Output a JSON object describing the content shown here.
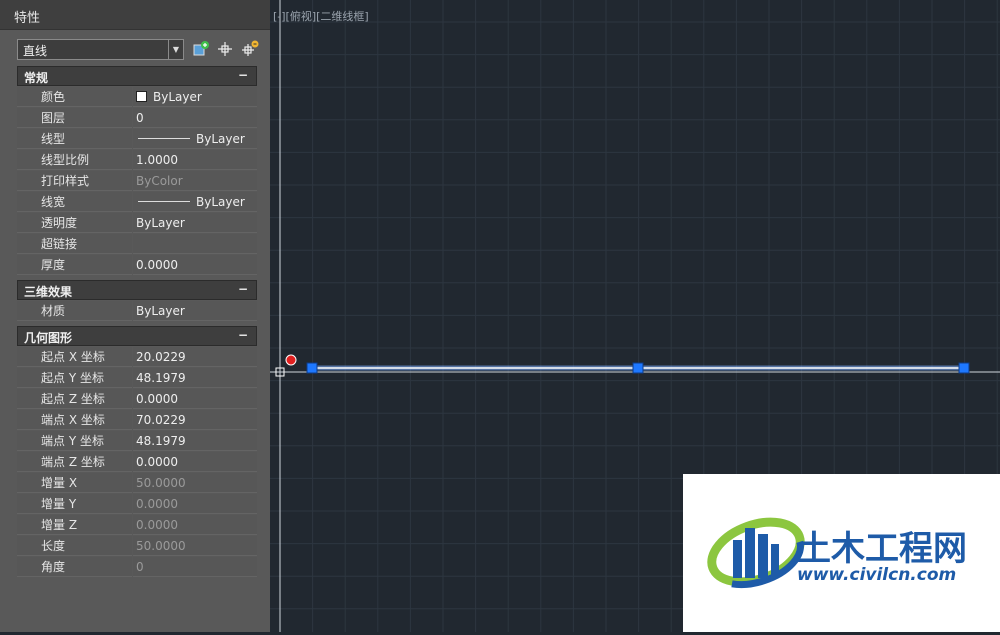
{
  "panel": {
    "title": "特性",
    "object_type": "直线",
    "buttons": [
      "quick-select-icon",
      "select-objects-icon",
      "toggle-pickadd-icon"
    ]
  },
  "sections": [
    {
      "title": "常规",
      "toggle": "−",
      "rows": [
        {
          "label": "颜色",
          "value": "ByLayer",
          "swatch": "#ffffff"
        },
        {
          "label": "图层",
          "value": "0"
        },
        {
          "label": "线型",
          "value": "ByLayer",
          "line": true
        },
        {
          "label": "线型比例",
          "value": "1.0000"
        },
        {
          "label": "打印样式",
          "value": "ByColor",
          "dim": true
        },
        {
          "label": "线宽",
          "value": "ByLayer",
          "line": true
        },
        {
          "label": "透明度",
          "value": "ByLayer"
        },
        {
          "label": "超链接",
          "value": ""
        },
        {
          "label": "厚度",
          "value": "0.0000"
        }
      ]
    },
    {
      "title": "三维效果",
      "toggle": "−",
      "rows": [
        {
          "label": "材质",
          "value": "ByLayer"
        }
      ]
    },
    {
      "title": "几何图形",
      "toggle": "−",
      "rows": [
        {
          "label": "起点 X 坐标",
          "value": "20.0229"
        },
        {
          "label": "起点 Y 坐标",
          "value": "48.1979"
        },
        {
          "label": "起点 Z 坐标",
          "value": "0.0000"
        },
        {
          "label": "端点 X 坐标",
          "value": "70.0229"
        },
        {
          "label": "端点 Y 坐标",
          "value": "48.1979"
        },
        {
          "label": "端点 Z 坐标",
          "value": "0.0000"
        },
        {
          "label": "增量 X",
          "value": "50.0000",
          "dim": true
        },
        {
          "label": "增量 Y",
          "value": "0.0000",
          "dim": true
        },
        {
          "label": "增量 Z",
          "value": "0.0000",
          "dim": true
        },
        {
          "label": "长度",
          "value": "50.0000",
          "dim": true
        },
        {
          "label": "角度",
          "value": "0",
          "dim": true
        }
      ]
    }
  ],
  "viewport": {
    "label": "[-][俯视][二维线框]",
    "background": "#212830",
    "grid_color": "#2d3640",
    "line_color": "#ffffff",
    "grip_color": "#1e78ff"
  },
  "watermark": {
    "brand": "土木工程网",
    "url": "www.civilcn.com"
  }
}
